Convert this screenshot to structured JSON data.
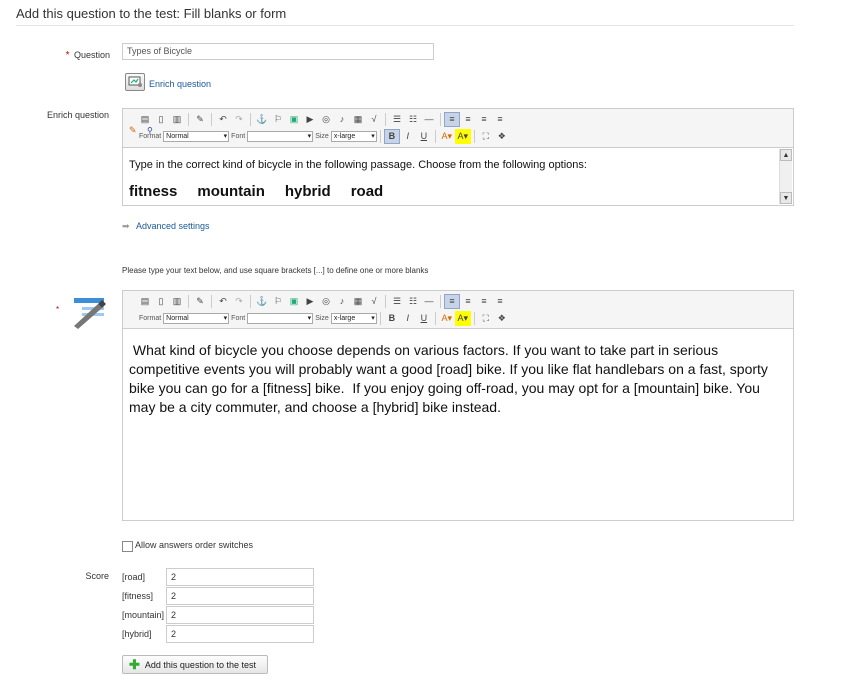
{
  "page": {
    "title": "Add this question to the test: Fill blanks or form"
  },
  "question": {
    "label": "Question",
    "required_mark": "*",
    "value": "Types of Bicycle"
  },
  "enrich": {
    "link_label": "Enrich question",
    "label": "Enrich question",
    "editor": {
      "format_label": "Format",
      "format_value": "Normal",
      "font_label": "Font",
      "font_value": "",
      "size_label": "Size",
      "size_value": "x-large",
      "text_line1": "Type in the correct kind of bicycle in the following passage. Choose from the following options:",
      "options": [
        "fitness",
        "mountain",
        "hybrid",
        "road"
      ]
    },
    "advanced_settings_label": "Advanced settings"
  },
  "blanks": {
    "instruction": "Please type your text below, and use square brackets [...] to define one or more blanks",
    "required_mark": "*",
    "editor": {
      "format_label": "Format",
      "format_value": "Normal",
      "font_label": "Font",
      "font_value": "",
      "size_label": "Size",
      "size_value": "x-large",
      "text": " What kind of bicycle you choose depends on various factors. If you want to take part in serious competitive events you will probably want a good [road] bike. If you like flat handlebars on a fast, sporty bike you can go for a [fitness] bike.  If you enjoy going off-road, you may opt for a [mountain] bike. You may be a city commuter, and choose a [hybrid] bike instead."
    }
  },
  "options": {
    "allow_switch_label": "Allow answers order switches"
  },
  "score": {
    "label": "Score",
    "rows": [
      {
        "blank": "[road]",
        "value": "2"
      },
      {
        "blank": "[fitness]",
        "value": "2"
      },
      {
        "blank": "[mountain]",
        "value": "2"
      },
      {
        "blank": "[hybrid]",
        "value": "2"
      }
    ]
  },
  "actions": {
    "add_label": "Add this question to the test"
  },
  "colors": {
    "link": "#1a5a9a",
    "required": "#cc0000",
    "toolbar_active": "#c7d4e8"
  }
}
